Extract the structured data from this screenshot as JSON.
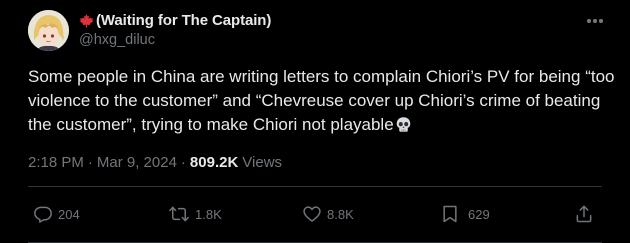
{
  "author": {
    "display_name": "(Waiting for The Captain)",
    "handle": "@hxg_diluc",
    "flag_icon": "maple-leaf-icon"
  },
  "tweet": {
    "text": "Some people in China are writing letters to complain Chiori’s PV for being “too violence to the customer” and “Chevreuse cover up Chiori’s crime of beating the customer”, trying to make Chiori not playable",
    "emoji_icon": "skull-icon"
  },
  "meta": {
    "time": "2:18 PM",
    "dot1": "·",
    "date": "Mar 9, 2024",
    "dot2": "·",
    "views_count": "809.2K",
    "views_label": "Views"
  },
  "actions": {
    "replies": "204",
    "retweets": "1.8K",
    "likes": "8.8K",
    "bookmarks": "629"
  },
  "colors": {
    "background": "#000000",
    "primary_text": "#e7e9ea",
    "secondary_text": "#71767b",
    "flag_red": "#e0323a",
    "divider": "#2f3336"
  }
}
